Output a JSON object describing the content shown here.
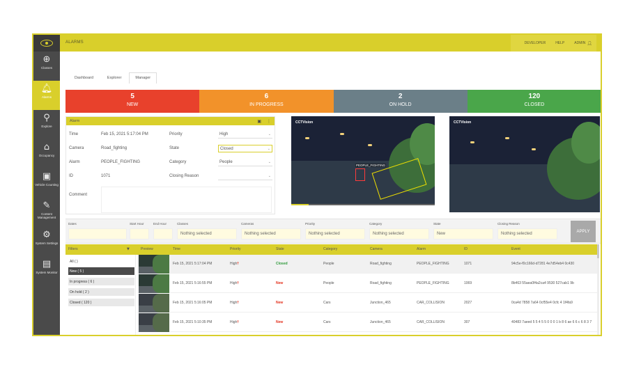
{
  "app": {
    "title": "ALARMS"
  },
  "topbar": {
    "links": [
      "DEVELOPER",
      "HELP",
      "ADMIN"
    ]
  },
  "sidebar": {
    "items": [
      {
        "label": "Classes",
        "icon": "classes-icon"
      },
      {
        "label": "Alarms",
        "icon": "bell-icon"
      },
      {
        "label": "Explore",
        "icon": "telescope-icon"
      },
      {
        "label": "Occupancy",
        "icon": "house-icon"
      },
      {
        "label": "Vehicle Counting",
        "icon": "vehicle-counting-icon"
      },
      {
        "label": "Content Management",
        "icon": "content-icon"
      },
      {
        "label": "System Settings",
        "icon": "gear-icon"
      },
      {
        "label": "System Monitor",
        "icon": "monitor-icon"
      }
    ]
  },
  "tabs": [
    "Dashboard",
    "Explorer",
    "Manager"
  ],
  "status_cards": [
    {
      "count": "5",
      "label": "NEW",
      "color": "#e8412c"
    },
    {
      "count": "6",
      "label": "IN PROGRESS",
      "color": "#f2922a"
    },
    {
      "count": "2",
      "label": "ON HOLD",
      "color": "#6b7f88"
    },
    {
      "count": "120",
      "label": "CLOSED",
      "color": "#4aa64a"
    }
  ],
  "alarm": {
    "header": "Alarm",
    "time_label": "Time",
    "time_value": "Feb 15, 2021 5:17:04 PM",
    "camera_label": "Camera",
    "camera_value": "Road_fighting",
    "alarm_label": "Alarm",
    "alarm_value": "PEOPLE_FIGHTING",
    "id_label": "ID",
    "id_value": "1071",
    "comment_label": "Comment",
    "priority_label": "Priority",
    "priority_value": "High",
    "state_label": "State",
    "state_value": "Closed",
    "category_label": "Category",
    "category_value": "People",
    "closing_label": "Closing Reason",
    "closing_value": ""
  },
  "videos": [
    {
      "tag": "CCTVision",
      "detection": "PEOPLE_FIGHTING"
    },
    {
      "tag": "CCTVision",
      "detection": ""
    }
  ],
  "filterbar": {
    "dates_label": "Dates",
    "start_label": "Start Hour",
    "end_label": "End Hour",
    "classes_label": "Classes",
    "classes_value": "Nothing selected",
    "cameras_label": "Cameras",
    "cameras_value": "Nothing selected",
    "priority_label": "Priority",
    "priority_value": "Nothing selected",
    "category_label": "Category",
    "category_value": "Nothing selected",
    "state_label": "State",
    "state_value": "New",
    "closing_label": "Closing Reason",
    "closing_value": "Nothing selected",
    "apply_label": "APPLY"
  },
  "table": {
    "headers": {
      "filters": "Filters",
      "preview": "Preview",
      "time": "Time",
      "priority": "Priority",
      "state": "State",
      "category": "Category",
      "camera": "Camera",
      "alarm": "Alarm",
      "id": "ID",
      "event": "Event"
    },
    "filters": [
      "All ( )",
      "New ( 5 )",
      "In progress ( 6 )",
      "On hold ( 2 )",
      "Closed ( 120 )"
    ],
    "rows": [
      {
        "time": "Feb 15, 2021 5:17:04 PM",
        "priority": "High",
        "state": "Closed",
        "category": "People",
        "camera": "Road_fighting",
        "alarm": "PEOPLE_FIGHTING",
        "id": "1071",
        "event": "94c5e-f0c166d-d7281 4e7d54eb4 0c430"
      },
      {
        "time": "Feb 15, 2021 5:16:55 PM",
        "priority": "High",
        "state": "New",
        "category": "People",
        "camera": "Road_fighting",
        "alarm": "PEOPLE_FIGHTING",
        "id": "1069",
        "event": "8b463 55aea0f4a2ca4 9530 527cab1 9b"
      },
      {
        "time": "Feb 15, 2021 5:16:05 PM",
        "priority": "High",
        "state": "New",
        "category": "Cars",
        "camera": "Junction_465",
        "alarm": "CAR_COLLISION",
        "id": "2027",
        "event": "0ca4d 7858 7a64 0cf55e4 0cfc 4 1f4fa9"
      },
      {
        "time": "Feb 15, 2021 5:10:35 PM",
        "priority": "High",
        "state": "New",
        "category": "Cars",
        "camera": "Junction_465",
        "alarm": "CAR_COLLISION",
        "id": "307",
        "event": "40483 7aeed 5 5 4 5 5 0 0 0 1 b 8 6 ae 6 6 c 6 8 3 7"
      }
    ]
  }
}
